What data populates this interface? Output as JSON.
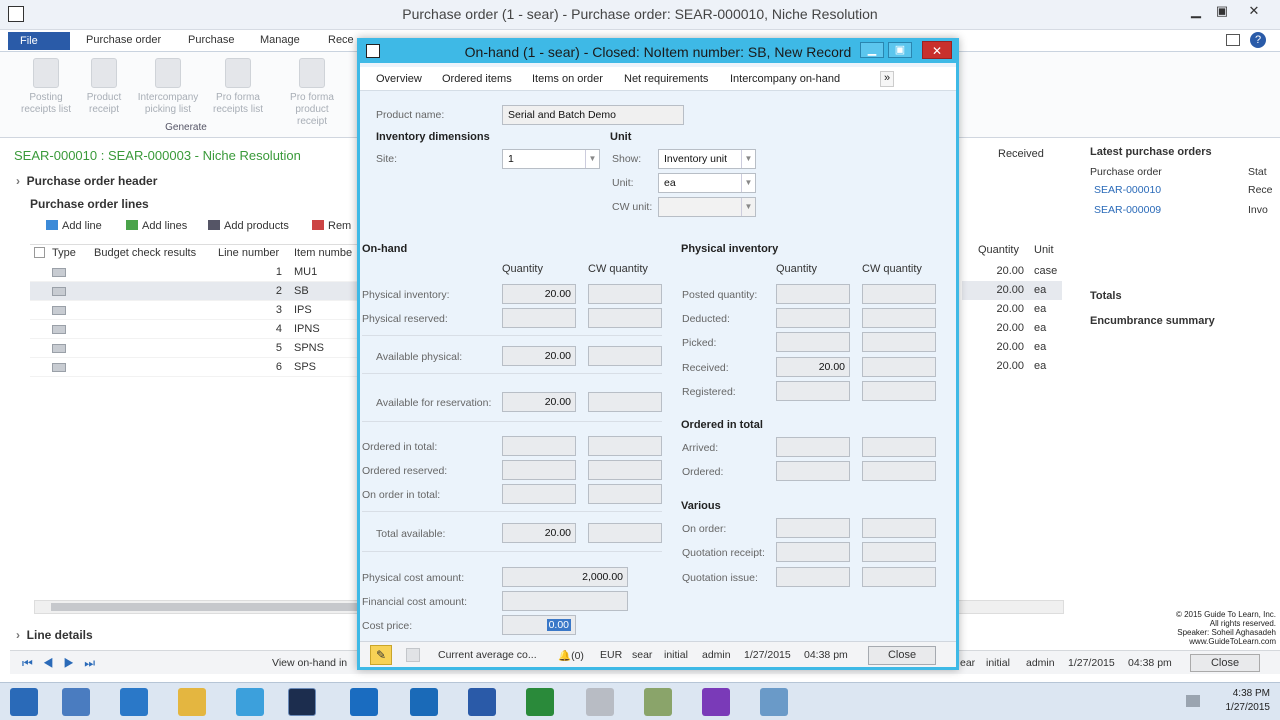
{
  "main": {
    "title": "Purchase order (1 - sear) - Purchase order: SEAR-000010, Niche Resolution",
    "menu": {
      "file": "File",
      "tabs": [
        "Purchase order",
        "Purchase",
        "Manage",
        "Rece"
      ]
    },
    "ribbon": {
      "buttons": [
        "Posting receipts list",
        "Product receipt",
        "Intercompany picking list",
        "Pro forma receipts list",
        "Pro forma product receipt"
      ],
      "group": "Generate"
    },
    "record_title": "SEAR-000010 : SEAR-000003 - Niche Resolution",
    "header_section": "Purchase order header",
    "lines_section": "Purchase order lines",
    "line_details": "Line details",
    "toolbar": {
      "add_line": "Add line",
      "add_lines": "Add lines",
      "add_products": "Add products",
      "remove": "Rem"
    },
    "columns": [
      "Type",
      "Budget check results",
      "Line number",
      "Item numbe"
    ],
    "rows": [
      {
        "line": "1",
        "item": "MU1",
        "qty": "20.00",
        "unit": "case"
      },
      {
        "line": "2",
        "item": "SB",
        "qty": "20.00",
        "unit": "ea"
      },
      {
        "line": "3",
        "item": "IPS",
        "qty": "20.00",
        "unit": "ea"
      },
      {
        "line": "4",
        "item": "IPNS",
        "qty": "20.00",
        "unit": "ea"
      },
      {
        "line": "5",
        "item": "SPNS",
        "qty": "20.00",
        "unit": "ea"
      },
      {
        "line": "6",
        "item": "SPS",
        "qty": "20.00",
        "unit": "ea"
      }
    ],
    "right_columns": {
      "quantity": "Quantity",
      "unit": "Unit"
    },
    "received_label": "Received",
    "factbox": {
      "latest_title": "Latest purchase orders",
      "col_po": "Purchase order",
      "col_stat": "Stat",
      "orders": [
        {
          "po": "SEAR-000010",
          "stat": "Rece"
        },
        {
          "po": "SEAR-000009",
          "stat": "Invo"
        }
      ],
      "totals": "Totals",
      "encumbrance": "Encumbrance summary"
    },
    "status": {
      "view": "View on-hand in",
      "mid": "ear",
      "initial": "initial",
      "user": "admin",
      "date": "1/27/2015",
      "time": "04:38 pm",
      "close": "Close"
    }
  },
  "dialog": {
    "title": "On-hand (1 - sear) - Closed: NoItem number: SB, New Record",
    "tabs": [
      "Overview",
      "Ordered items",
      "Items on order",
      "Net requirements",
      "Intercompany on-hand"
    ],
    "more": "»",
    "product_name_label": "Product name:",
    "product_name": "Serial and Batch Demo",
    "inv_dims": "Inventory dimensions",
    "site_label": "Site:",
    "site": "1",
    "unit_header": "Unit",
    "show_label": "Show:",
    "show": "Inventory unit",
    "unit_label": "Unit:",
    "unit": "ea",
    "cw_unit_label": "CW unit:",
    "onhand_header": "On-hand",
    "phys_header": "Physical inventory",
    "col_quantity": "Quantity",
    "col_cw": "CW quantity",
    "onhand": [
      {
        "label": "Physical inventory:",
        "qty": "20.00"
      },
      {
        "label": "Physical reserved:",
        "qty": ""
      },
      {
        "label": "Available physical:",
        "qty": "20.00"
      },
      {
        "label": "Available for reservation:",
        "qty": "20.00"
      },
      {
        "label": "Ordered in total:",
        "qty": ""
      },
      {
        "label": "Ordered reserved:",
        "qty": ""
      },
      {
        "label": "On order in total:",
        "qty": ""
      },
      {
        "label": "Total available:",
        "qty": "20.00"
      }
    ],
    "physical": [
      {
        "label": "Posted quantity:",
        "qty": ""
      },
      {
        "label": "Deducted:",
        "qty": ""
      },
      {
        "label": "Picked:",
        "qty": ""
      },
      {
        "label": "Received:",
        "qty": "20.00"
      },
      {
        "label": "Registered:",
        "qty": ""
      }
    ],
    "ordered_header": "Ordered in total",
    "ordered": [
      {
        "label": "Arrived:",
        "qty": ""
      },
      {
        "label": "Ordered:",
        "qty": ""
      }
    ],
    "various_header": "Various",
    "various": [
      {
        "label": "On order:",
        "qty": ""
      },
      {
        "label": "Quotation receipt:",
        "qty": ""
      },
      {
        "label": "Quotation issue:",
        "qty": ""
      }
    ],
    "phys_cost_label": "Physical cost amount:",
    "phys_cost": "2,000.00",
    "fin_cost_label": "Financial cost amount:",
    "cost_price_label": "Cost price:",
    "cost_price": "0.00",
    "status": {
      "method": "Current average co...",
      "count": "(0)",
      "currency": "EUR",
      "company": "sear",
      "initial": "initial",
      "user": "admin",
      "date": "1/27/2015",
      "time": "04:38 pm",
      "close": "Close"
    }
  },
  "taskbar": {
    "time": "4:38 PM",
    "date": "1/27/2015"
  },
  "watermark": {
    "line1": "© 2015 Guide To Learn, Inc.",
    "line2": "All rights reserved.",
    "line3": "Speaker: Soheil Aghasadeh",
    "line4": "www.GuideToLearn.com"
  }
}
